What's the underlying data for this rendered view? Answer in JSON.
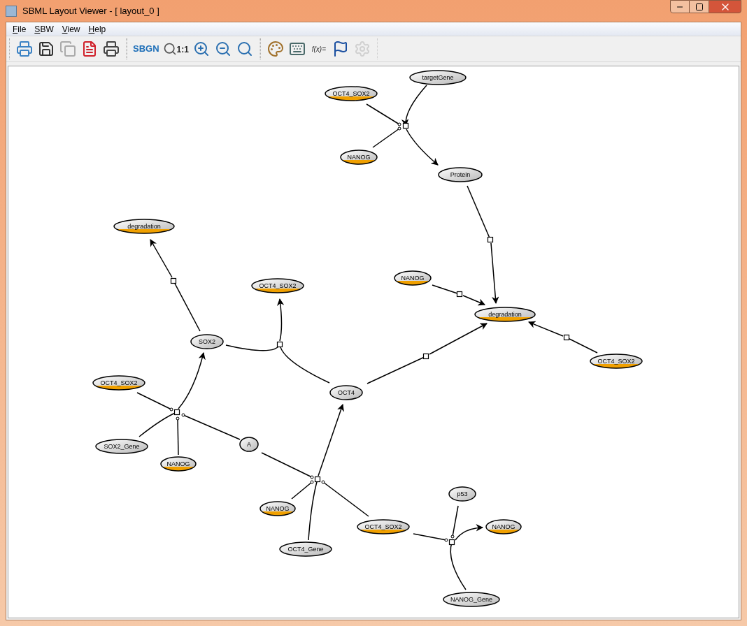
{
  "window": {
    "title": "SBML Layout Viewer - [ layout_0 ]"
  },
  "menu": [
    "File",
    "SBW",
    "View",
    "Help"
  ],
  "toolbar": [
    [
      {
        "kind": "print-preview"
      },
      {
        "kind": "save"
      },
      {
        "kind": "copy"
      },
      {
        "kind": "pdf"
      },
      {
        "kind": "print"
      }
    ],
    [
      {
        "kind": "sbgn",
        "label": "SBGN"
      },
      {
        "kind": "zoom-reset",
        "label": "1:1"
      },
      {
        "kind": "zoom-in"
      },
      {
        "kind": "zoom-out"
      },
      {
        "kind": "zoom-fit"
      }
    ],
    [
      {
        "kind": "palette"
      },
      {
        "kind": "typewriter"
      },
      {
        "kind": "formula",
        "label": "f(x)="
      },
      {
        "kind": "flag"
      },
      {
        "kind": "settings",
        "disabled": true
      }
    ]
  ],
  "diagram": {
    "species": [
      {
        "label": "targetGene",
        "clone": false
      },
      {
        "label": "OCT4_SOX2",
        "clone": true
      },
      {
        "label": "NANOG",
        "clone": true
      },
      {
        "label": "Protein",
        "clone": false
      },
      {
        "label": "degradation",
        "clone": true
      },
      {
        "label": "NANOG",
        "clone": true
      },
      {
        "label": "OCT4_SOX2",
        "clone": true
      },
      {
        "label": "degradation",
        "clone": true
      },
      {
        "label": "SOX2",
        "clone": false
      },
      {
        "label": "OCT4_SOX2",
        "clone": true
      },
      {
        "label": "OCT4_SOX2",
        "clone": true
      },
      {
        "label": "OCT4",
        "clone": false
      },
      {
        "label": "SOX2_Gene",
        "clone": false
      },
      {
        "label": "A",
        "clone": false
      },
      {
        "label": "NANOG",
        "clone": true
      },
      {
        "label": "p53",
        "clone": false
      },
      {
        "label": "NANOG",
        "clone": true
      },
      {
        "label": "OCT4_SOX2",
        "clone": true
      },
      {
        "label": "NANOG",
        "clone": true
      },
      {
        "label": "OCT4_Gene",
        "clone": false
      },
      {
        "label": "NANOG_Gene",
        "clone": false
      }
    ]
  }
}
